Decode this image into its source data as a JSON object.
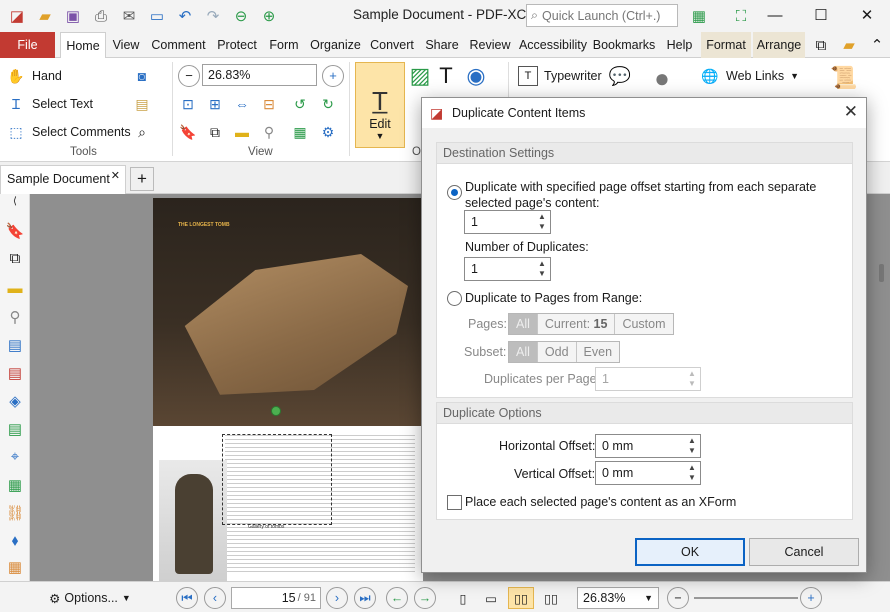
{
  "window": {
    "title": "Sample Document - PDF-XCha...",
    "quick_launch_placeholder": "Quick Launch (Ctrl+.)"
  },
  "menu": {
    "tabs": [
      "File",
      "Home",
      "View",
      "Comment",
      "Protect",
      "Form",
      "Organize",
      "Convert",
      "Share",
      "Review",
      "Accessibility",
      "Bookmarks",
      "Help",
      "Format",
      "Arrange"
    ]
  },
  "ribbon": {
    "hand": "Hand",
    "select_text": "Select Text",
    "select_comments": "Select Comments",
    "tools_group": "Tools",
    "zoom_value": "26.83%",
    "view_group": "View",
    "edit_label": "Edit",
    "edit_group": "O",
    "typewriter": "Typewriter",
    "web_links": "Web Links"
  },
  "doc_tab": {
    "label": "Sample Document"
  },
  "page_content": {
    "heading1": "THE LONGEST TOMB",
    "caption": "Gallery of tombs"
  },
  "dialog": {
    "title": "Duplicate Content Items",
    "dest_header": "Destination Settings",
    "option1": "Duplicate with specified page offset starting from each separate selected page's content:",
    "offset_value": "1",
    "num_dup_label": "Number of Duplicates:",
    "num_dup_value": "1",
    "option2": "Duplicate to Pages from Range:",
    "pages_label": "Pages:",
    "pages_all": "All",
    "pages_current_prefix": "Current:",
    "pages_current_num": "15",
    "pages_custom": "Custom",
    "subset_label": "Subset:",
    "subset_all": "All",
    "subset_odd": "Odd",
    "subset_even": "Even",
    "dup_per_page_label": "Duplicates per Page:",
    "dup_per_page_value": "1",
    "dup_opts_header": "Duplicate Options",
    "h_offset_label": "Horizontal Offset:",
    "h_offset_value": "0 mm",
    "v_offset_label": "Vertical Offset:",
    "v_offset_value": "0 mm",
    "xform_label": "Place each selected page's content as an XForm",
    "ok": "OK",
    "cancel": "Cancel"
  },
  "status": {
    "options": "Options...",
    "page_current": "15",
    "page_total": "/ 91",
    "zoom": "26.83%"
  },
  "colors": {
    "file_tab": "#c23a32",
    "accent_blue": "#0b63c4",
    "edit_button": "#fde4a8"
  }
}
